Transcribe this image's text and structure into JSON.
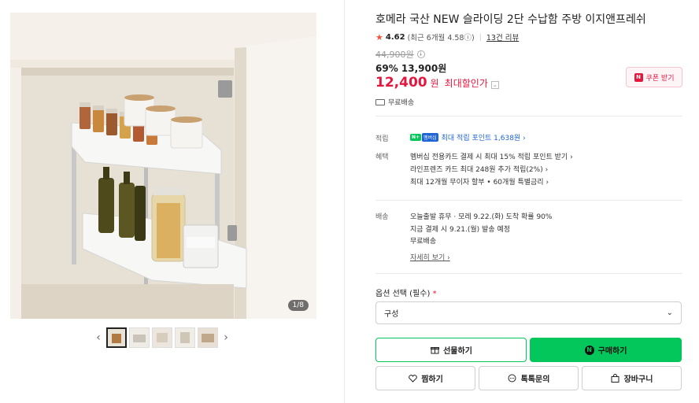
{
  "gallery": {
    "counter": "1/8",
    "prev_arrow": "‹",
    "next_arrow": "›",
    "thumb_count": 5
  },
  "product": {
    "title": "호메라 국산 NEW 슬라이딩 2단 수납함 주방 이지앤프레쉬",
    "rating_score": "4.62",
    "rating_detail": "(최근 6개월 4.58ⓘ)",
    "review_count": "13건 리뷰",
    "original_price": "44,900원",
    "discount_line": "69% 13,900원",
    "best_price": "12,400",
    "best_price_unit": "원",
    "best_price_label": "최대할인가",
    "coupon_badge": "N",
    "coupon_label": "쿠폰 받기",
    "free_shipping": "무료배송"
  },
  "points": {
    "label": "적립",
    "npay_badge": "N+",
    "member_badge": "멤버십",
    "text": "최대 적립 포인트 1,638원 ›"
  },
  "benefits": {
    "label": "혜택",
    "lines": [
      "멤버십 전용카드 결제 시 최대 15% 적립 포인트 받기 ›",
      "라인프렌즈 카드 최대 248원 추가 적립(2%) ›",
      "최대 12개월 무이자 할부 • 60개월 특별금리 ›"
    ]
  },
  "shipping": {
    "label": "배송",
    "lines": [
      "오늘출발 휴무 · 모레 9.22.(화) 도착 확률 90%",
      "지금 결제 시 9.21.(월) 발송 예정",
      "무료배송"
    ],
    "more_link": "자세히 보기 ›"
  },
  "options": {
    "label": "옵션 선택 (필수)",
    "required_mark": "*",
    "selected": "구성",
    "chevron": "⌄"
  },
  "buttons": {
    "gift": "선물하기",
    "buy": "구매하기",
    "buy_badge": "N",
    "wish": "찜하기",
    "talk": "톡톡문의",
    "cart": "장바구니"
  },
  "colors": {
    "accent_green": "#03c75a",
    "price_red": "#e3183f",
    "point_blue": "#1e64d6"
  }
}
